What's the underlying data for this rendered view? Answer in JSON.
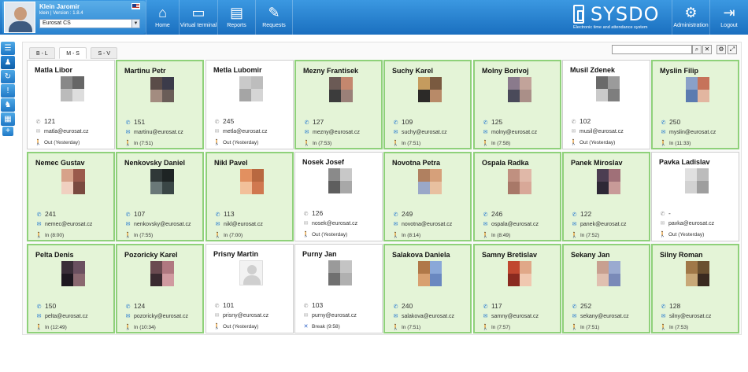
{
  "app": {
    "user_name": "Klein Jaromir",
    "version_line": "klein | Version : 1.8.4",
    "company": "Eurosat CS",
    "logo_text": "SYSDO",
    "logo_sub": "Electronic time and attendance system"
  },
  "nav": {
    "home": "Home",
    "virtual_terminal": "Virtual terminal",
    "reports": "Reports",
    "requests": "Requests",
    "administration": "Administration",
    "logout": "Logout"
  },
  "tabs": [
    "B - L",
    "M - S",
    "S - V"
  ],
  "active_tab": 1,
  "search": {
    "value": "",
    "search_icon": "search-icon",
    "clear_icon": "close-icon"
  },
  "colors": {
    "accent": "#1f78c6",
    "in_bg": "#e4f4d7",
    "in_border": "#8fd17a"
  },
  "employees": [
    {
      "name": "Matla Libor",
      "ext": "121",
      "email": "matla@eurosat.cz",
      "status": "Out (Yesterday)",
      "state": "out",
      "photo": [
        "#888",
        "#666",
        "#bbb",
        "#ddd"
      ]
    },
    {
      "name": "Martinu Petr",
      "ext": "151",
      "email": "martinu@eurosat.cz",
      "status": "In (7:51)",
      "state": "in",
      "photo": [
        "#5a4c48",
        "#3b3b4a",
        "#a38c80",
        "#6a5d58"
      ]
    },
    {
      "name": "Metla Lubomir",
      "ext": "245",
      "email": "metla@eurosat.cz",
      "status": "Out (Yesterday)",
      "state": "out",
      "photo": [
        "#c9c9c9",
        "#bdbdbd",
        "#a5a5a5",
        "#d5d5d5"
      ]
    },
    {
      "name": "Mezny Frantisek",
      "ext": "127",
      "email": "mezny@eurosat.cz",
      "status": "In (7:53)",
      "state": "in",
      "photo": [
        "#6b5a55",
        "#c4876e",
        "#3c3c3c",
        "#9a8078"
      ]
    },
    {
      "name": "Suchy Karel",
      "ext": "109",
      "email": "suchy@eurosat.cz",
      "status": "In (7:51)",
      "state": "in",
      "photo": [
        "#c59b5e",
        "#7a5a40",
        "#2c2a28",
        "#b88a68"
      ]
    },
    {
      "name": "Molny Borivoj",
      "ext": "125",
      "email": "molny@eurosat.cz",
      "status": "In (7:58)",
      "state": "in",
      "photo": [
        "#8a7a8c",
        "#c2a39a",
        "#4a4a5a",
        "#aa8f88"
      ]
    },
    {
      "name": "Musil Zdenek",
      "ext": "102",
      "email": "musil@eurosat.cz",
      "status": "Out (Yesterday)",
      "state": "out",
      "photo": [
        "#6a6a6a",
        "#9b9b9b",
        "#cacaca",
        "#7e7e7e"
      ]
    },
    {
      "name": "Myslin Filip",
      "ext": "250",
      "email": "myslin@eurosat.cz",
      "status": "In (11:33)",
      "state": "in",
      "photo": [
        "#8aa0c8",
        "#c6735a",
        "#5b7bb0",
        "#e2b6a0"
      ]
    },
    {
      "name": "Nemec Gustav",
      "ext": "241",
      "email": "nemec@eurosat.cz",
      "status": "In (8:00)",
      "state": "in",
      "photo": [
        "#d7a28a",
        "#9a5a4c",
        "#f0d0c0",
        "#7a4a40"
      ]
    },
    {
      "name": "Nenkovsky Daniel",
      "ext": "107",
      "email": "nenkovsky@eurosat.cz",
      "status": "In (7:55)",
      "state": "in",
      "photo": [
        "#303838",
        "#1e2424",
        "#6a7878",
        "#3a4646"
      ]
    },
    {
      "name": "Nikl Pavel",
      "ext": "113",
      "email": "nikl@eurosat.cz",
      "status": "In (7:00)",
      "state": "in",
      "photo": [
        "#e29060",
        "#b86840",
        "#f2c09a",
        "#d07850"
      ]
    },
    {
      "name": "Nosek Josef",
      "ext": "126",
      "email": "nosek@eurosat.cz",
      "status": "Out (Yesterday)",
      "state": "out",
      "photo": [
        "#8a8a8a",
        "#c8c8c8",
        "#5e5e5e",
        "#a8a8a8"
      ]
    },
    {
      "name": "Novotna Petra",
      "ext": "249",
      "email": "novotna@eurosat.cz",
      "status": "In (8:14)",
      "state": "in",
      "photo": [
        "#b08060",
        "#d6a07a",
        "#9aa8c8",
        "#e8c0a0"
      ]
    },
    {
      "name": "Ospala Radka",
      "ext": "246",
      "email": "ospala@eurosat.cz",
      "status": "In (8:49)",
      "state": "in",
      "photo": [
        "#c09080",
        "#e0b8a8",
        "#a87868",
        "#d8a898"
      ]
    },
    {
      "name": "Panek Miroslav",
      "ext": "122",
      "email": "panek@eurosat.cz",
      "status": "In (7:52)",
      "state": "in",
      "photo": [
        "#4c3e52",
        "#a07078",
        "#2e2836",
        "#c89a98"
      ]
    },
    {
      "name": "Pavka Ladislav",
      "ext": "-",
      "email": "pavka@eurosat.cz",
      "status": "Out (Yesterday)",
      "state": "out",
      "photo": [
        "#e0e0e0",
        "#bcbcbc",
        "#d2d2d2",
        "#9e9e9e"
      ]
    },
    {
      "name": "Pelta Denis",
      "ext": "150",
      "email": "pelta@eurosat.cz",
      "status": "In (12:49)",
      "state": "in",
      "photo": [
        "#3a2e38",
        "#6a5060",
        "#1e1820",
        "#8a6870"
      ]
    },
    {
      "name": "Pozoricky Karel",
      "ext": "124",
      "email": "pozoricky@eurosat.cz",
      "status": "In (10:34)",
      "state": "in",
      "photo": [
        "#6a4a50",
        "#b07880",
        "#3a2a30",
        "#d09aa0"
      ]
    },
    {
      "name": "Prisny Martin",
      "ext": "101",
      "email": "prisny@eurosat.cz",
      "status": "Out (Yesterday)",
      "state": "out",
      "photo": []
    },
    {
      "name": "Purny Jan",
      "ext": "103",
      "email": "purny@eurosat.cz",
      "status": "Break  (9:58)",
      "state": "break",
      "photo": [
        "#9a9a9a",
        "#c4c4c4",
        "#707070",
        "#b0b0b0"
      ]
    },
    {
      "name": "Salakova Daniela",
      "ext": "240",
      "email": "salakova@eurosat.cz",
      "status": "In (7:51)",
      "state": "in",
      "photo": [
        "#b07848",
        "#8aa8d8",
        "#d8a070",
        "#6a88c0"
      ]
    },
    {
      "name": "Samny Bretislav",
      "ext": "117",
      "email": "samny@eurosat.cz",
      "status": "In (7:57)",
      "state": "in",
      "photo": [
        "#c04830",
        "#e0a888",
        "#8a2a20",
        "#f0c8b0"
      ]
    },
    {
      "name": "Sekany Jan",
      "ext": "252",
      "email": "sekany@eurosat.cz",
      "status": "In (7:51)",
      "state": "in",
      "photo": [
        "#c8a090",
        "#9aaad0",
        "#e0c0b0",
        "#7a8ab8"
      ]
    },
    {
      "name": "Silny Roman",
      "ext": "128",
      "email": "silny@eurosat.cz",
      "status": "In (7:53)",
      "state": "in",
      "photo": [
        "#a07848",
        "#6a5030",
        "#c8a878",
        "#3a2a20"
      ]
    }
  ]
}
